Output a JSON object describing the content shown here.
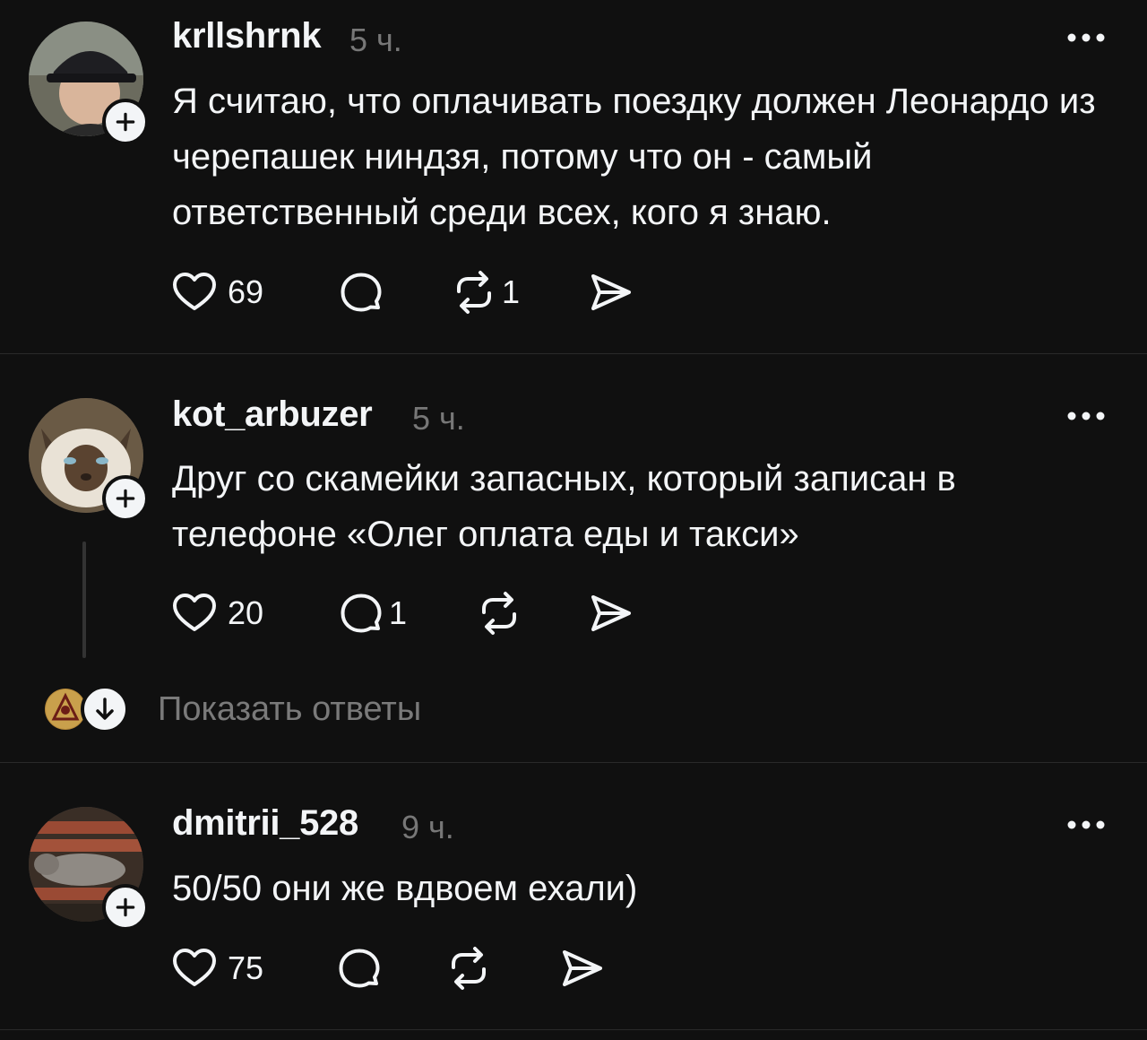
{
  "posts": [
    {
      "username": "krllshrnk",
      "time": "5 ч.",
      "text": "Я считаю, что оплачивать поездку должен Леонардо из черепашек ниндзя, потому что он - самый ответственный среди всех, кого я знаю.",
      "likes": "69",
      "comments": "",
      "reposts": "1"
    },
    {
      "username": "kot_arbuzer",
      "time": "5 ч.",
      "text": "Друг со скамейки запасных, который записан в телефоне «Олег оплата еды и такси»",
      "likes": "20",
      "comments": "1",
      "reposts": "",
      "show_replies_label": "Показать ответы"
    },
    {
      "username": "dmitrii_528",
      "time": "9 ч.",
      "text": "50/50 они же вдвоем ехали)",
      "likes": "75",
      "comments": "",
      "reposts": ""
    }
  ],
  "icons": {
    "follow": "plus-icon",
    "more": "more-dots-icon",
    "like": "heart-icon",
    "comment": "comment-bubble-icon",
    "repost": "repost-icon",
    "share": "send-icon",
    "expand": "arrow-down-icon"
  },
  "colors": {
    "background": "#101010",
    "text": "#f3f5f7",
    "muted": "#777777",
    "divider": "#2a2a2a"
  }
}
